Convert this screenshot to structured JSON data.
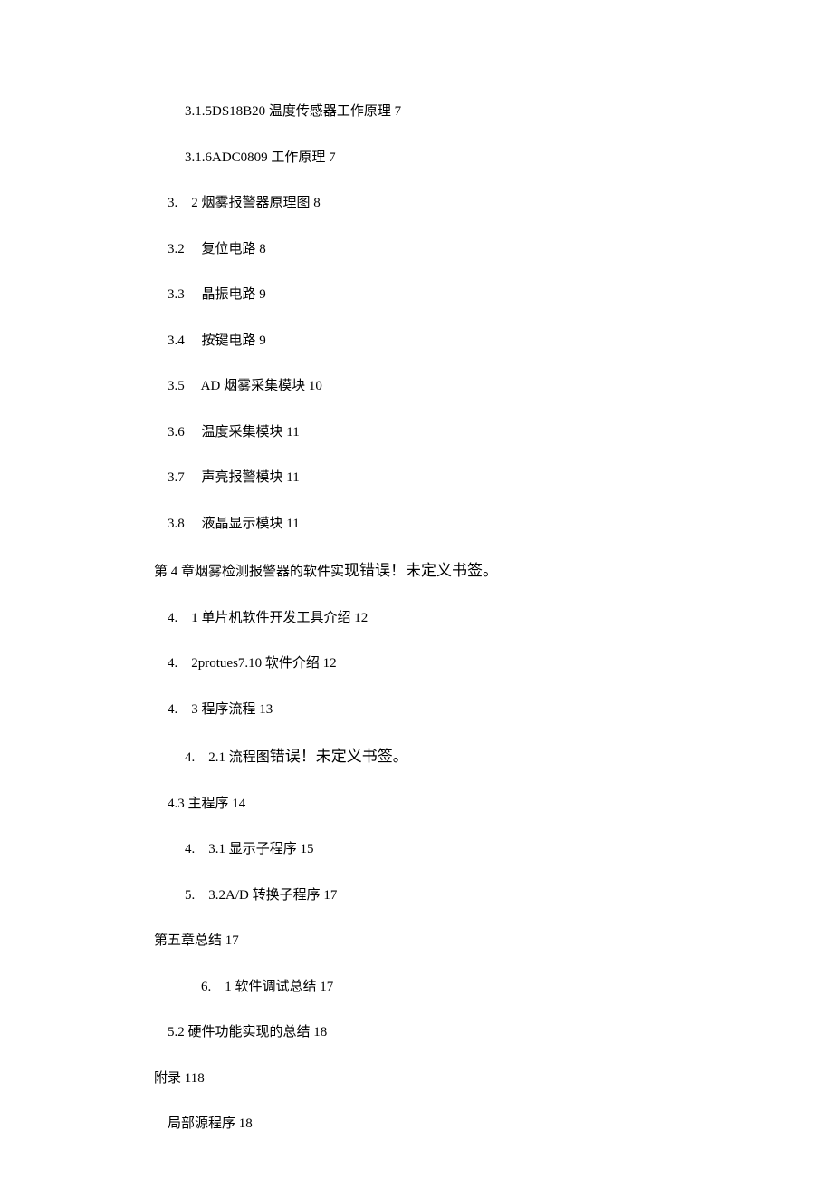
{
  "toc": [
    {
      "indent": 2,
      "text": "3.1.5DS18B20 温度传感器工作原理 7"
    },
    {
      "indent": 2,
      "text": "3.1.6ADC0809 工作原理 7"
    },
    {
      "indent": 1,
      "text": "3.　2 烟雾报警器原理图 8"
    },
    {
      "indent": 1,
      "text": "3.2　 复位电路 8"
    },
    {
      "indent": 1,
      "text": "3.3　 晶振电路 9"
    },
    {
      "indent": 1,
      "text": "3.4　 按键电路 9"
    },
    {
      "indent": 1,
      "text": "3.5　 AD 烟雾采集模块 10"
    },
    {
      "indent": 1,
      "text": "3.6　 温度采集模块 11"
    },
    {
      "indent": 1,
      "text": "3.7　 声亮报警模块 11"
    },
    {
      "indent": 1,
      "text": "3.8　 液晶显示模块 11"
    },
    {
      "indent": 0,
      "mixed": true,
      "prefix": "第 4 章烟雾检测报警器的软件实",
      "suffix": "现错误！未定义书签。"
    },
    {
      "indent": 1,
      "text": "4.　1 单片机软件开发工具介绍 12"
    },
    {
      "indent": 1,
      "text": "4.　2protues7.10 软件介绍 12"
    },
    {
      "indent": 1,
      "text": "4.　3 程序流程 13"
    },
    {
      "indent": 2,
      "mixed": true,
      "prefix": "4.　2.1 流程图",
      "suffix": "错误！未定义书签。"
    },
    {
      "indent": 1,
      "text": "4.3 主程序 14"
    },
    {
      "indent": 2,
      "text": "4.　3.1 显示子程序 15"
    },
    {
      "indent": 2,
      "text": "5.　3.2A/D 转换子程序 17"
    },
    {
      "indent": 0,
      "text": "第五章总结 17"
    },
    {
      "indent": 3,
      "text": "6.　1 软件调试总结 17"
    },
    {
      "indent": 1,
      "text": "5.2 硬件功能实现的总结 18"
    },
    {
      "indent": 0,
      "text": "附录 118"
    },
    {
      "indent": 1,
      "text": "局部源程序 18"
    }
  ]
}
